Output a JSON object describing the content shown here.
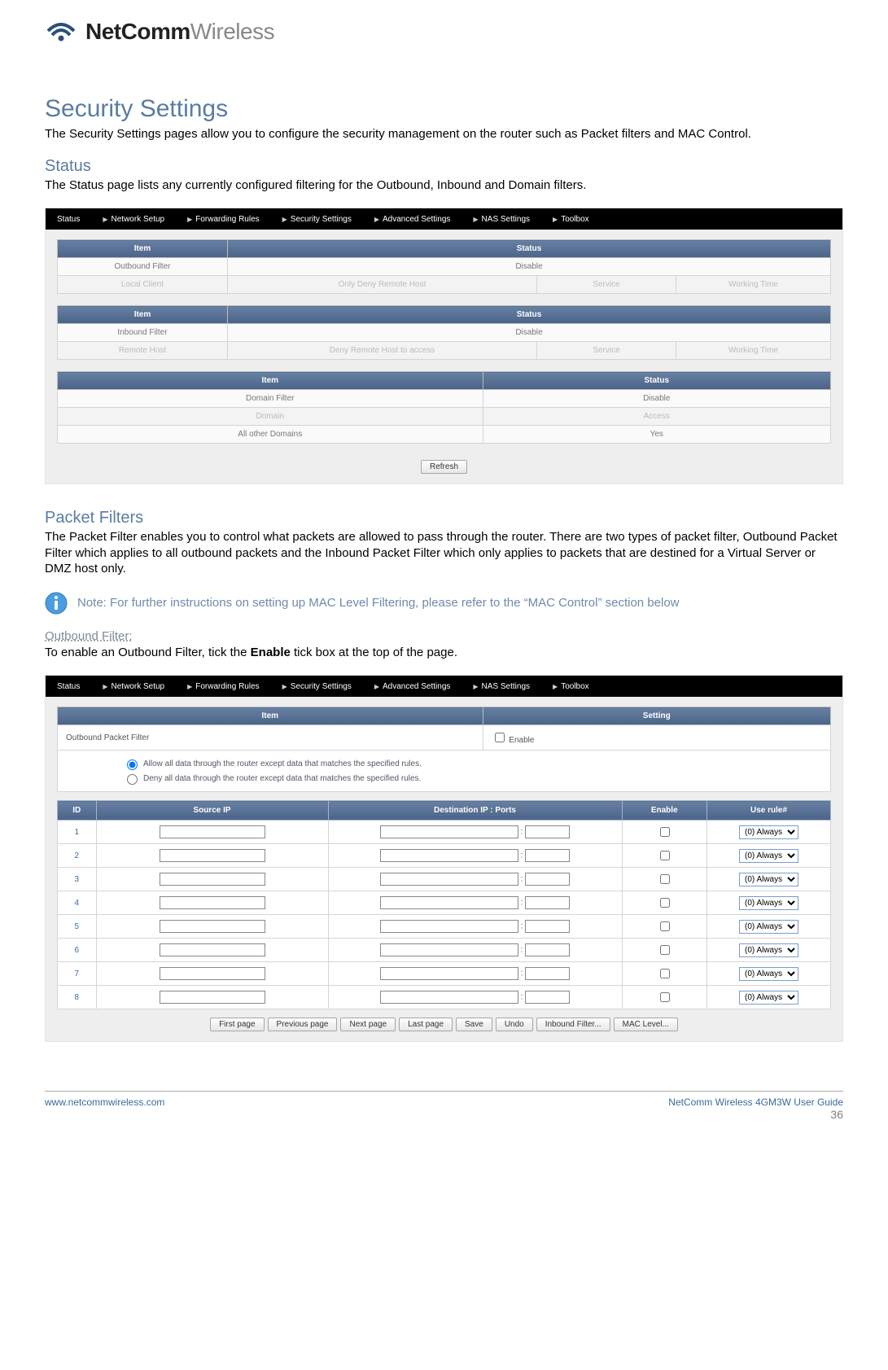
{
  "brand": {
    "part1": "NetComm",
    "part2": "Wireless"
  },
  "headings": {
    "h1": "Security Settings",
    "h1_desc": "The Security Settings pages allow you to configure the security management on the router such as Packet filters and MAC Control.",
    "status": "Status",
    "status_desc": "The Status page lists any currently configured filtering for the Outbound, Inbound and Domain filters.",
    "packet_filters": "Packet Filters",
    "pf_desc": "The Packet Filter enables you to control what packets are allowed to pass through the router. There are two types of packet filter, Outbound Packet Filter which applies to all outbound packets and the Inbound Packet Filter which only applies to packets that are destined for a Virtual Server or DMZ host only.",
    "note": "Note: For further instructions on setting up MAC Level Filtering, please refer to the “MAC Control” section below",
    "outbound": "Outbound Filter:",
    "outbound_desc_pre": "To enable an Outbound Filter, tick the ",
    "outbound_desc_bold": "Enable",
    "outbound_desc_post": " tick box at the top of the page."
  },
  "nav": {
    "items": [
      "Status",
      "Network Setup",
      "Forwarding Rules",
      "Security Settings",
      "Advanced Settings",
      "NAS Settings",
      "Toolbox"
    ]
  },
  "status_panel": {
    "t1": {
      "headers": [
        "Item",
        "Status"
      ],
      "row": [
        "Outbound Filter",
        "Disable"
      ],
      "sub": [
        "Local Client",
        "Only Deny Remote Host",
        "Service",
        "Working Time"
      ]
    },
    "t2": {
      "headers": [
        "Item",
        "Status"
      ],
      "row": [
        "Inbound Filter",
        "Disable"
      ],
      "sub": [
        "Remote Host",
        "Deny Remote Host to access",
        "Service",
        "Working Time"
      ]
    },
    "t3": {
      "headers": [
        "Item",
        "Status"
      ],
      "row": [
        "Domain Filter",
        "Disable"
      ],
      "sub": [
        "Domain",
        "Access"
      ],
      "row2": [
        "All other Domains",
        "Yes"
      ]
    },
    "refresh": "Refresh"
  },
  "of_panel": {
    "item_setting_headers": [
      "Item",
      "Setting"
    ],
    "row_label": "Outbound Packet Filter",
    "enable_label": "Enable",
    "radio_allow": "Allow all data through the router except data that matches the specified rules.",
    "radio_deny": "Deny all data through the router except data that matches the specified rules.",
    "rules_headers": [
      "ID",
      "Source IP",
      "Destination IP : Ports",
      "Enable",
      "Use rule#"
    ],
    "rule_option": "(0) Always",
    "buttons": [
      "First page",
      "Previous page",
      "Next page",
      "Last page",
      "Save",
      "Undo",
      "Inbound Filter...",
      "MAC Level..."
    ]
  },
  "footer": {
    "url": "www.netcommwireless.com",
    "guide": "NetComm Wireless 4GM3W User Guide",
    "page": "36"
  }
}
